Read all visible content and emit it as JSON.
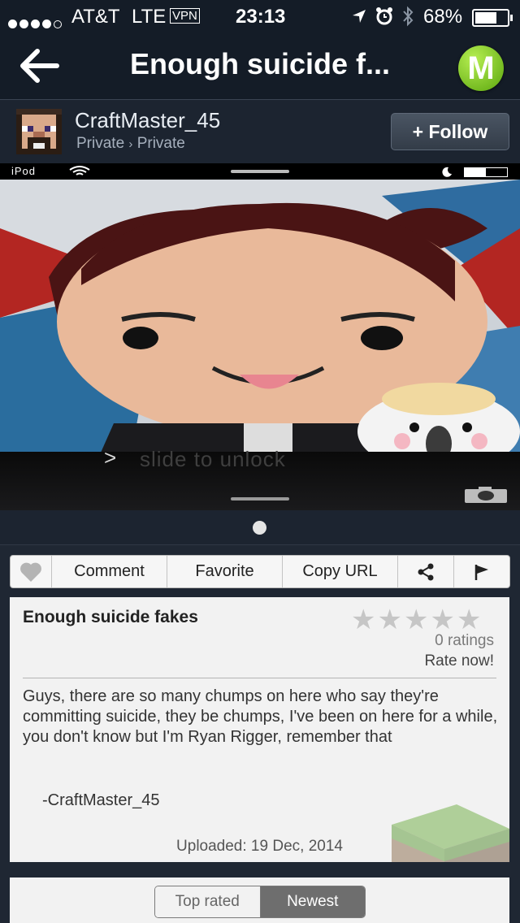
{
  "status_bar": {
    "carrier": "AT&T",
    "network": "LTE",
    "vpn": "VPN",
    "time": "23:13",
    "battery": "68%",
    "battery_level": 0.68
  },
  "nav": {
    "title": "Enough suicide f...",
    "logo_letter": "M"
  },
  "user": {
    "username": "CraftMaster_45",
    "visibility": "Private",
    "category": "Private",
    "separator": "›",
    "follow_label": "+ Follow"
  },
  "screenshot": {
    "device_label": "iPod",
    "slide_text": "slide to unlock",
    "slide_arrow": ">"
  },
  "actions": {
    "comment": "Comment",
    "favorite": "Favorite",
    "copy_url": "Copy URL"
  },
  "post": {
    "title": "Enough suicide fakes",
    "ratings": "0 ratings",
    "rate_now": "Rate now!",
    "body": "Guys, there are so many chumps on here who say they're committing suicide, they be chumps, I've been on here for a while, you don't know but I'm Ryan Rigger, remember that",
    "signature": "-CraftMaster_45",
    "uploaded": "Uploaded: 19 Dec, 2014",
    "star_count": 5
  },
  "sort": {
    "top_rated": "Top rated",
    "newest": "Newest",
    "selected": "newest"
  },
  "colors": {
    "nav_bg": "#141c27",
    "accent_green": "#6cc417",
    "card_bg": "#f2f2f2"
  }
}
